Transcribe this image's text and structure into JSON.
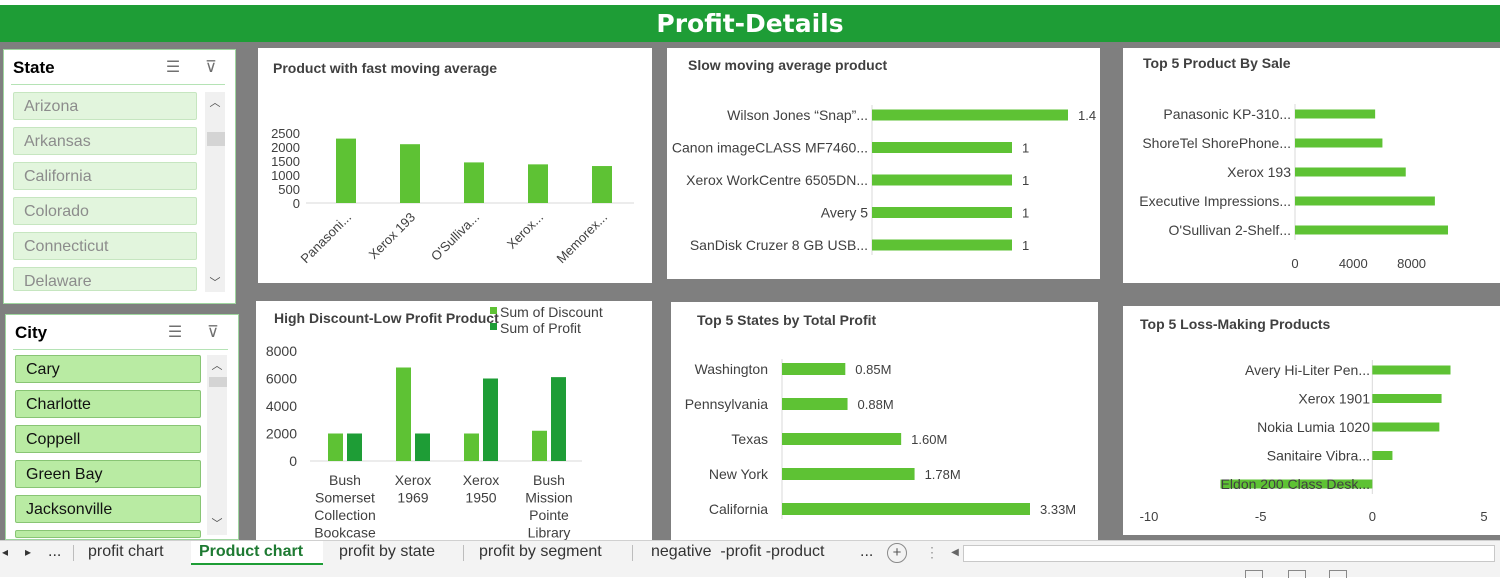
{
  "dashboard_title": "Profit-Details",
  "state_slicer": {
    "header": "State",
    "items": [
      "Arizona",
      "Arkansas",
      "California",
      "Colorado",
      "Connecticut",
      "Delaware"
    ]
  },
  "city_slicer": {
    "header": "City",
    "items": [
      "Cary",
      "Charlotte",
      "Coppell",
      "Green Bay",
      "Jacksonville"
    ]
  },
  "icons": {
    "multiselect": "multi-select-icon",
    "clear_filter": "clear-filter-icon",
    "scroll_up": "scroll-up-icon",
    "scroll_down": "scroll-down-icon"
  },
  "colors": {
    "banner": "#1e9d36",
    "bar_light": "#5ec234",
    "bar_dark": "#1e9d36",
    "slicer_item_state": "#e2f5dd",
    "slicer_item_city": "#b9eba3"
  },
  "sheet_tabs": {
    "ellipsis_left": "...",
    "tabs": [
      "profit chart",
      "Product chart",
      "profit by state",
      "profit by segment",
      "negative  -profit -product"
    ],
    "active": "Product chart",
    "ellipsis_right": "..."
  },
  "chart_data": [
    {
      "id": "fast",
      "type": "bar",
      "title": "Product with fast moving average",
      "categories": [
        "Panasoni...",
        "Xerox 193",
        "O'Sulliva...",
        "Xerox...",
        "Memorex..."
      ],
      "values": [
        2300,
        2100,
        1450,
        1380,
        1320
      ],
      "yticks": [
        "2500",
        "2000",
        "1500",
        "1000",
        "500",
        "0"
      ],
      "ylim": [
        0,
        2500
      ]
    },
    {
      "id": "slow",
      "type": "bar",
      "orientation": "horizontal",
      "title": "Slow moving average product",
      "categories": [
        "Wilson Jones “Snap”...",
        "Canon imageCLASS MF7460...",
        "Xerox WorkCentre 6505DN...",
        "Avery 5",
        "SanDisk Cruzer 8 GB USB..."
      ],
      "values": [
        1.4,
        1,
        1,
        1,
        1
      ],
      "data_labels": [
        "1.4",
        "1",
        "1",
        "1",
        "1"
      ],
      "xlim": [
        0,
        1.4
      ]
    },
    {
      "id": "topsale",
      "type": "bar",
      "orientation": "horizontal",
      "title": "Top 5 Product By Sale",
      "categories": [
        "Panasonic KP-310...",
        "ShoreTel ShorePhone...",
        "Xerox 193",
        "Executive Impressions...",
        "O'Sullivan 2-Shelf..."
      ],
      "values": [
        5500,
        6000,
        7600,
        9600,
        10500
      ],
      "xticks": [
        "0",
        "4000",
        "8000"
      ],
      "xlim": [
        0,
        10500
      ]
    },
    {
      "id": "discount",
      "type": "bar",
      "title": "High Discount-Low Profit Product",
      "categories": [
        "Bush Somerset Collection Bookcase",
        "Xerox 1969",
        "Xerox 1950",
        "Bush Mission Pointe Library"
      ],
      "category_lines": [
        [
          "Bush",
          "Somerset",
          "Collection",
          "Bookcase"
        ],
        [
          "Xerox",
          "1969"
        ],
        [
          "Xerox",
          "1950"
        ],
        [
          "Bush",
          "Mission",
          "Pointe",
          "Library"
        ]
      ],
      "series": [
        {
          "name": "Sum of Discount",
          "values": [
            2000,
            6800,
            2000,
            2200
          ]
        },
        {
          "name": "Sum of Profit",
          "values": [
            2000,
            2000,
            6000,
            6100
          ]
        }
      ],
      "yticks": [
        "8000",
        "6000",
        "4000",
        "2000",
        "0"
      ],
      "ylim": [
        0,
        8000
      ]
    },
    {
      "id": "states",
      "type": "bar",
      "orientation": "horizontal",
      "title": "Top 5 States by Total Profit",
      "categories": [
        "Washington",
        "Pennsylvania",
        "Texas",
        "New York",
        "California"
      ],
      "values": [
        0.85,
        0.88,
        1.6,
        1.78,
        3.33
      ],
      "data_labels": [
        "0.85M",
        "0.88M",
        "1.60M",
        "1.78M",
        "3.33M"
      ],
      "xlim": [
        0,
        3.33
      ]
    },
    {
      "id": "loss",
      "type": "bar",
      "orientation": "horizontal",
      "title": "Top 5 Loss-Making Products",
      "categories": [
        "Avery Hi-Liter Pen...",
        "Xerox 1901",
        "Nokia Lumia 1020",
        "Sanitaire Vibra...",
        "Eldon 200 Class Desk..."
      ],
      "values": [
        3.5,
        3.1,
        3.0,
        0.9,
        -6.8
      ],
      "xticks": [
        "-10",
        "-5",
        "0",
        "5"
      ],
      "xlim": [
        -10,
        5
      ]
    }
  ]
}
